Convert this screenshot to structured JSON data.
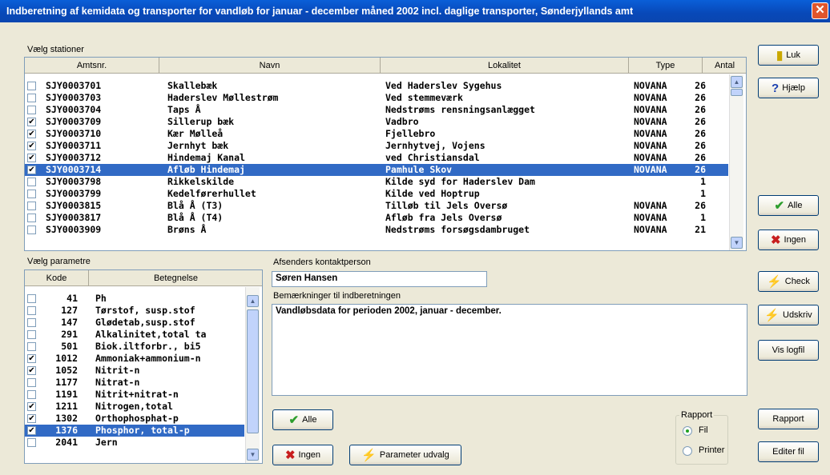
{
  "window": {
    "title": "Indberetning af kemidata og transporter for vandløb for januar - december måned 2002 incl. daglige transporter, Sønderjyllands amt",
    "close_glyph": "✕"
  },
  "stations": {
    "label": "Vælg stationer",
    "columns": [
      "Amtsnr.",
      "Navn",
      "Lokalitet",
      "Type",
      "Antal"
    ],
    "rows": [
      {
        "checked": false,
        "amtsnr": "SJY0003701",
        "navn": "Skallebæk",
        "lokalitet": "Ved Haderslev Sygehus",
        "type": "NOVANA",
        "antal": "26",
        "selected": false
      },
      {
        "checked": false,
        "amtsnr": "SJY0003703",
        "navn": "Haderslev Møllestrøm",
        "lokalitet": "Ved stemmeværk",
        "type": "NOVANA",
        "antal": "26",
        "selected": false
      },
      {
        "checked": false,
        "amtsnr": "SJY0003704",
        "navn": "Taps Å",
        "lokalitet": "Nedstrøms rensningsanlægget",
        "type": "NOVANA",
        "antal": "26",
        "selected": false
      },
      {
        "checked": true,
        "amtsnr": "SJY0003709",
        "navn": "Sillerup bæk",
        "lokalitet": "Vadbro",
        "type": "NOVANA",
        "antal": "26",
        "selected": false
      },
      {
        "checked": true,
        "amtsnr": "SJY0003710",
        "navn": "Kær Mølleå",
        "lokalitet": "Fjellebro",
        "type": "NOVANA",
        "antal": "26",
        "selected": false
      },
      {
        "checked": true,
        "amtsnr": "SJY0003711",
        "navn": "Jernhyt bæk",
        "lokalitet": "Jernhytvej, Vojens",
        "type": "NOVANA",
        "antal": "26",
        "selected": false
      },
      {
        "checked": true,
        "amtsnr": "SJY0003712",
        "navn": "Hindemaj Kanal",
        "lokalitet": "ved Christiansdal",
        "type": "NOVANA",
        "antal": "26",
        "selected": false
      },
      {
        "checked": true,
        "amtsnr": "SJY0003714",
        "navn": "Afløb Hindemaj",
        "lokalitet": "Pamhule Skov",
        "type": "NOVANA",
        "antal": "26",
        "selected": true
      },
      {
        "checked": false,
        "amtsnr": "SJY0003798",
        "navn": "Rikkelskilde",
        "lokalitet": "Kilde syd for Haderslev Dam",
        "type": "",
        "antal": "1",
        "selected": false
      },
      {
        "checked": false,
        "amtsnr": "SJY0003799",
        "navn": "Kedelførerhullet",
        "lokalitet": "Kilde ved Hoptrup",
        "type": "",
        "antal": "1",
        "selected": false
      },
      {
        "checked": false,
        "amtsnr": "SJY0003815",
        "navn": "Blå Å (T3)",
        "lokalitet": "Tilløb til Jels Oversø",
        "type": "NOVANA",
        "antal": "26",
        "selected": false
      },
      {
        "checked": false,
        "amtsnr": "SJY0003817",
        "navn": "Blå Å (T4)",
        "lokalitet": "Afløb fra Jels Oversø",
        "type": "NOVANA",
        "antal": "1",
        "selected": false
      },
      {
        "checked": false,
        "amtsnr": "SJY0003909",
        "navn": "Brøns Å",
        "lokalitet": "Nedstrøms forsøgsdambruget",
        "type": "NOVANA",
        "antal": "21",
        "selected": false
      }
    ]
  },
  "parameters": {
    "label": "Vælg parametre",
    "columns": [
      "Kode",
      "Betegnelse"
    ],
    "rows": [
      {
        "checked": false,
        "kode": "41",
        "betegnelse": "Ph",
        "selected": false
      },
      {
        "checked": false,
        "kode": "127",
        "betegnelse": "Tørstof, susp.stof",
        "selected": false
      },
      {
        "checked": false,
        "kode": "147",
        "betegnelse": "Glødetab,susp.stof",
        "selected": false
      },
      {
        "checked": false,
        "kode": "291",
        "betegnelse": "Alkalinitet,total ta",
        "selected": false
      },
      {
        "checked": false,
        "kode": "501",
        "betegnelse": "Biok.iltforbr., bi5",
        "selected": false
      },
      {
        "checked": true,
        "kode": "1012",
        "betegnelse": "Ammoniak+ammonium-n",
        "selected": false
      },
      {
        "checked": true,
        "kode": "1052",
        "betegnelse": "Nitrit-n",
        "selected": false
      },
      {
        "checked": false,
        "kode": "1177",
        "betegnelse": "Nitrat-n",
        "selected": false
      },
      {
        "checked": false,
        "kode": "1191",
        "betegnelse": "Nitrit+nitrat-n",
        "selected": false
      },
      {
        "checked": true,
        "kode": "1211",
        "betegnelse": "Nitrogen,total",
        "selected": false
      },
      {
        "checked": true,
        "kode": "1302",
        "betegnelse": "Orthophosphat-p",
        "selected": false
      },
      {
        "checked": true,
        "kode": "1376",
        "betegnelse": "Phosphor, total-p",
        "selected": true
      },
      {
        "checked": false,
        "kode": "2041",
        "betegnelse": "Jern",
        "selected": false
      }
    ]
  },
  "contact": {
    "label": "Afsenders kontaktperson",
    "value": "Søren Hansen"
  },
  "remarks": {
    "label": "Bemærkninger til indberetningen",
    "value": "Vandløbsdata for perioden 2002, januar - december."
  },
  "buttons": {
    "luk": "Luk",
    "hjaelp": "Hjælp",
    "alle_st": "Alle",
    "ingen_st": "Ingen",
    "check": "Check",
    "udskriv": "Udskriv",
    "vis_logfil": "Vis logfil",
    "alle_par": "Alle",
    "ingen_par": "Ingen",
    "parameter_udvalg": "Parameter udvalg",
    "rapport": "Rapport",
    "editer_fil": "Editer fil"
  },
  "rapport_group": {
    "label": "Rapport",
    "options": [
      "Fil",
      "Printer"
    ],
    "selected": "Fil"
  },
  "colors": {
    "selection": "#316ac5",
    "title": "#0a5fd8",
    "check_green": "#2e9e2e",
    "x_red": "#c81e1e",
    "lightning": "#f5d400"
  }
}
